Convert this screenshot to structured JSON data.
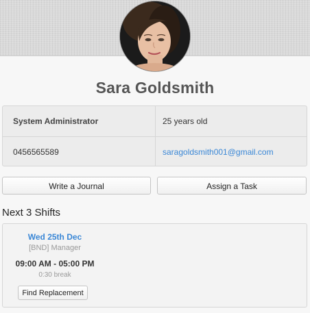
{
  "profile": {
    "name": "Sara Goldsmith",
    "avatar_icon": "profile-photo",
    "details": {
      "role": "System Administrator",
      "age": "25 years old",
      "phone": "0456565589",
      "email": "saragoldsmith001@gmail.com"
    }
  },
  "actions": {
    "write_journal": "Write a Journal",
    "assign_task": "Assign a Task"
  },
  "shifts": {
    "heading": "Next 3 Shifts",
    "items": [
      {
        "date": "Wed 25th Dec",
        "role": "[BND] Manager",
        "time": "09:00 AM - 05:00 PM",
        "break": "0:30 break",
        "button": "Find Replacement"
      }
    ]
  },
  "colors": {
    "link": "#3a87d6",
    "name_text": "#555555",
    "card_bg": "#ececec",
    "page_bg": "#f7f7f7"
  }
}
